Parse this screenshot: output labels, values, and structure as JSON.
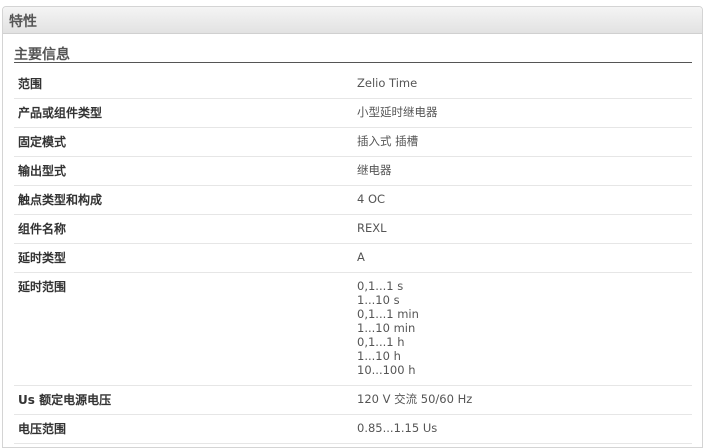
{
  "panel": {
    "title": "特性",
    "section_title": "主要信息"
  },
  "specs": [
    {
      "label": "范围",
      "values": [
        "Zelio Time"
      ]
    },
    {
      "label": "产品或组件类型",
      "values": [
        "小型延时继电器"
      ]
    },
    {
      "label": "固定模式",
      "values": [
        "插入式 插槽"
      ]
    },
    {
      "label": "输出型式",
      "values": [
        "继电器"
      ]
    },
    {
      "label": "触点类型和构成",
      "values": [
        "4 OC"
      ]
    },
    {
      "label": "组件名称",
      "values": [
        "REXL"
      ]
    },
    {
      "label": "延时类型",
      "values": [
        "A"
      ]
    },
    {
      "label": "延时范围",
      "values": [
        "0,1...1 s",
        "1...10 s",
        "0,1...1 min",
        "1...10 min",
        "0,1...1 h",
        "1...10 h",
        "10...100 h"
      ]
    },
    {
      "label": "Us 额定电源电压",
      "values": [
        "120 V 交流 50/60 Hz"
      ]
    },
    {
      "label": "电压范围",
      "values": [
        "0.85...1.15 Us"
      ]
    }
  ]
}
